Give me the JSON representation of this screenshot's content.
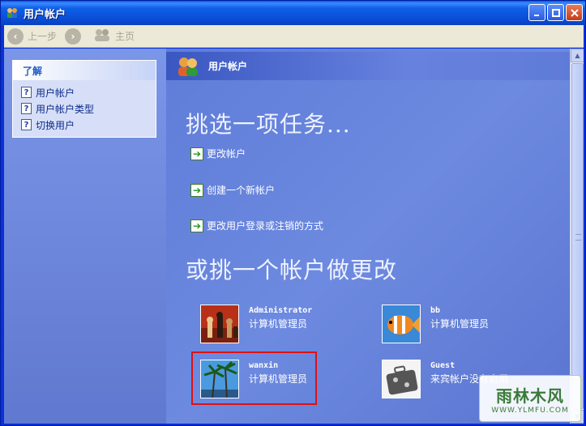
{
  "window": {
    "title": "用户帐户"
  },
  "toolbar": {
    "back_label": "上一步",
    "home_label": "主页"
  },
  "sidebar": {
    "box_title": "了解",
    "items": [
      {
        "label": "用户帐户"
      },
      {
        "label": "用户帐户类型"
      },
      {
        "label": "切换用户"
      }
    ]
  },
  "main": {
    "header_title": "用户帐户",
    "pick_task_heading": "挑选一项任务...",
    "tasks": [
      {
        "label": "更改帐户"
      },
      {
        "label": "创建一个新帐户"
      },
      {
        "label": "更改用户登录或注销的方式"
      }
    ],
    "pick_account_heading": "或挑一个帐户做更改",
    "accounts": [
      {
        "name": "Administrator",
        "role": "计算机管理员",
        "picture": "chess-picture"
      },
      {
        "name": "bb",
        "role": "计算机管理员",
        "picture": "fish-picture"
      },
      {
        "name": "wanxin",
        "role": "计算机管理员",
        "picture": "palm-tree-picture",
        "selected": true
      },
      {
        "name": "Guest",
        "role": "来宾帐户没有启用",
        "picture": "suitcase-picture"
      }
    ]
  },
  "watermark": {
    "main": "雨林木风",
    "sub": "WWW.YLMFU.COM"
  },
  "colors": {
    "titlebar": "#0a4fd8",
    "content_bg": "#6b84d6",
    "selection_border": "#e01010"
  }
}
